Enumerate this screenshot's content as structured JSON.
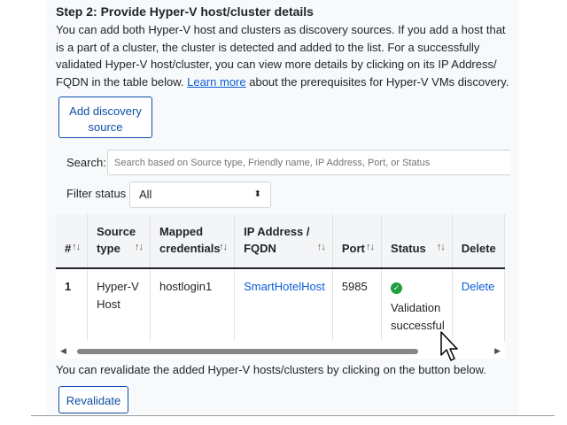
{
  "step": {
    "title": "Step 2: Provide Hyper-V host/cluster details",
    "description_before_link": "You can add both Hyper-V host and clusters as discovery sources. If you add a host that is a part of a cluster, the cluster is detected and added to the list. For a successfully validated Hyper-V host/cluster, you can view more details by clicking on its IP Address/ FQDN in the table below. ",
    "learn_more_link": "Learn more",
    "description_after_link": " about the prerequisites for Hyper-V VMs discovery."
  },
  "add_button_label": "Add discovery source",
  "search": {
    "label": "Search:",
    "placeholder": "Search based on Source type, Friendly name, IP Address, Port, or Status"
  },
  "filter": {
    "label": "Filter status",
    "selected": "All"
  },
  "table": {
    "headers": {
      "number": "#",
      "source_type": "Source type",
      "mapped_credentials": "Mapped credentials",
      "ip_fqdn": "IP Address / FQDN",
      "port": "Port",
      "status": "Status",
      "delete": "Delete"
    },
    "sort_icon": "sort-arrows-icon",
    "rows": [
      {
        "number": "1",
        "source_type": "Hyper-V Host",
        "mapped_credentials": "hostlogin1",
        "ip_fqdn": "SmartHotelHost",
        "port": "5985",
        "status": "Validation successful",
        "status_icon": "check-circle-icon",
        "delete": "Delete"
      }
    ]
  },
  "revalidate_text": "You can revalidate the added Hyper-V hosts/clusters by clicking on the button below.",
  "revalidate_button_label": "Revalidate",
  "colors": {
    "link": "#0b5ed7",
    "button_border": "#0d4ea6",
    "success": "#1e9e3e"
  }
}
